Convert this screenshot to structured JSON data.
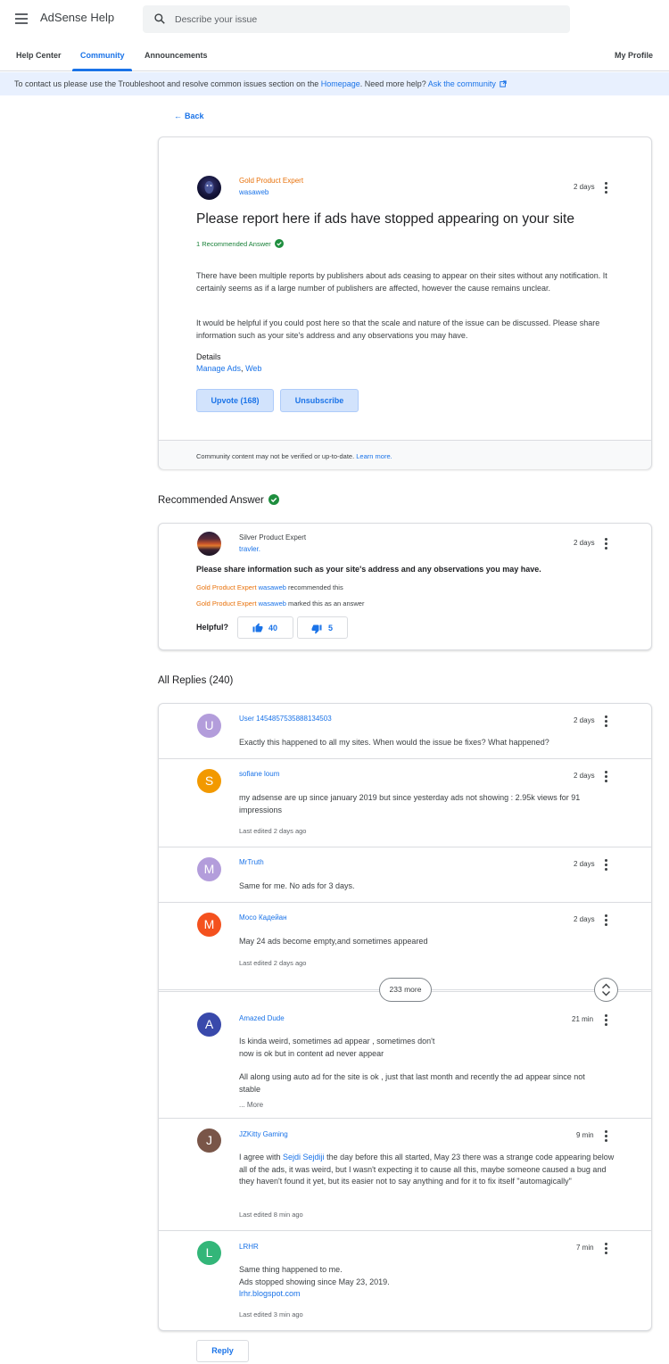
{
  "header": {
    "app_title": "AdSense Help",
    "search_placeholder": "Describe your issue",
    "tabs": [
      "Help Center",
      "Community",
      "Announcements"
    ],
    "my_profile": "My Profile"
  },
  "banner": {
    "text_1": "To contact us please use the Troubleshoot and resolve common issues section on the ",
    "homepage_link": "Homepage",
    "text_2": ". Need more help? ",
    "community_link": "Ask the community"
  },
  "back_label": "Back",
  "question": {
    "badge": "Gold Product Expert",
    "author": "wasaweb",
    "time": "2 days",
    "title": "Please report here if ads have stopped appearing on your site",
    "recommended": "1 Recommended Answer",
    "para_1": "There have been multiple reports by publishers about ads ceasing to appear on their sites without any notification. It certainly seems as if a large number of publishers are affected, however the cause remains unclear.",
    "para_2": "It would be helpful if you could post here so that the scale and nature of the issue can be discussed. Please share information such as your site's address and any observations you may have.",
    "details_label": "Details",
    "details_link_1": "Manage Ads",
    "details_sep": ", ",
    "details_link_2": "Web",
    "upvote_label": "Upvote (168)",
    "unsubscribe_label": "Unsubscribe",
    "footer_text": "Community content may not be verified or up-to-date. ",
    "footer_link": "Learn more."
  },
  "recommended": {
    "heading": "Recommended Answer",
    "badge": "Silver Product Expert",
    "author": "travler.",
    "time": "2 days",
    "answer": "Please share information such as your site's address and any observations you may have.",
    "line1_badge": "Gold Product Expert",
    "line1_user": "wasaweb",
    "line1_text": " recommended this",
    "line2_badge": "Gold Product Expert",
    "line2_user": "wasaweb",
    "line2_text": " marked this as an answer",
    "helpful_label": "Helpful?",
    "up_count": "40",
    "down_count": "5"
  },
  "replies_heading": "All Replies (240)",
  "replies": [
    {
      "letter": "U",
      "color": "#b39ddb",
      "name": "User 1454857535888134503",
      "time": "2 days",
      "text": "Exactly this happened to all my sites. When would the issue be fixes? What happened?",
      "edited": ""
    },
    {
      "letter": "S",
      "color": "#f29900",
      "name": "sofiane loum",
      "time": "2 days",
      "text": "my adsense are up since january 2019 but since yesterday ads not showing : 2.95k views for 91 impressions",
      "edited": "Last edited 2 days ago"
    },
    {
      "letter": "M",
      "color": "#b39ddb",
      "name": "MrTruth",
      "time": "2 days",
      "text": "Same for me. No ads for 3 days.",
      "edited": ""
    },
    {
      "letter": "M",
      "color": "#f4511e",
      "name": "Мосо Кадейан",
      "time": "2 days",
      "text": "May 24 ads become empty,and sometimes appeared",
      "edited": "Last edited 2 days ago"
    },
    {
      "letter": "A",
      "color": "#3949ab",
      "name": "Amazed Dude",
      "time": "21 min",
      "text_lines": [
        "Is kinda weird, sometimes ad appear , sometimes don't",
        "now is ok but in content ad never appear",
        "",
        "All along using auto ad for the site is ok , just that last month and recently the ad appear since not stable"
      ],
      "more": "... More"
    },
    {
      "letter": "J",
      "color": "#795548",
      "name": "JZKitty Gaming",
      "time": "9 min",
      "text_pre": "I agree with ",
      "text_link": "Sejdi Sejdiji",
      "text_post": " the day before this all started, May 23 there was a strange code appearing below all of the ads, it was weird, but I wasn't expecting it to cause all this, maybe someone caused a bug and they haven't found it yet, but its easier not to say anything and for it to fix itself \"automagically\"",
      "edited": "Last edited 8 min ago"
    },
    {
      "letter": "L",
      "color": "#33b679",
      "name": "LRHR",
      "time": "7 min",
      "text_lines": [
        "Same thing happened to me.",
        "Ads stopped showing since May 23, 2019."
      ],
      "link": "lrhr.blogspot.com",
      "edited": "Last edited 3 min ago"
    }
  ],
  "more_label": "233 more",
  "reply_button": "Reply"
}
